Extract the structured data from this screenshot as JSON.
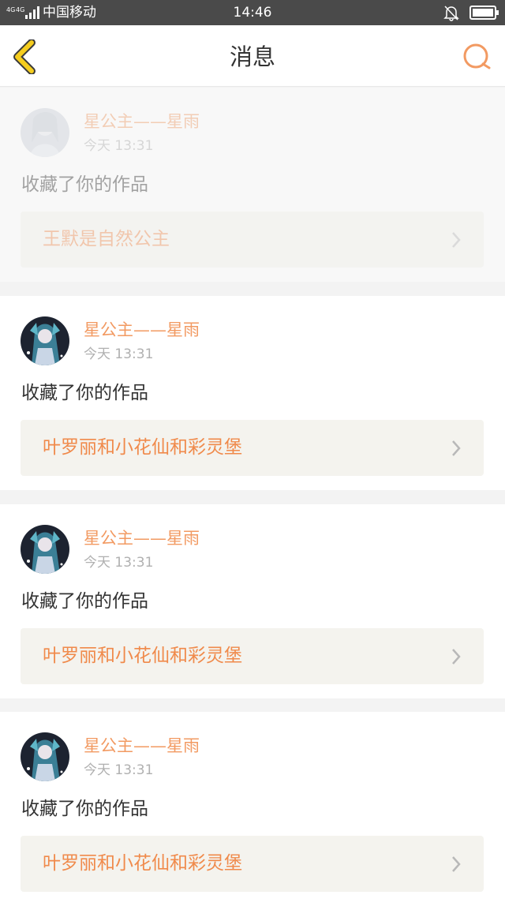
{
  "status_bar": {
    "network": "4G 4G",
    "carrier": "中国移动",
    "time": "14:46"
  },
  "header": {
    "title": "消息",
    "accent_color": "#f29a62",
    "back_color": "#f0c419"
  },
  "notifications": [
    {
      "user": "星公主——星雨",
      "time": "今天 13:31",
      "action": "收藏了你的作品",
      "work_title": "王默是自然公主",
      "faded": true
    },
    {
      "user": "星公主——星雨",
      "time": "今天 13:31",
      "action": "收藏了你的作品",
      "work_title": "叶罗丽和小花仙和彩灵堡"
    },
    {
      "user": "星公主——星雨",
      "time": "今天 13:31",
      "action": "收藏了你的作品",
      "work_title": "叶罗丽和小花仙和彩灵堡"
    },
    {
      "user": "星公主——星雨",
      "time": "今天 13:31",
      "action": "收藏了你的作品",
      "work_title": "叶罗丽和小花仙和彩灵堡"
    }
  ]
}
